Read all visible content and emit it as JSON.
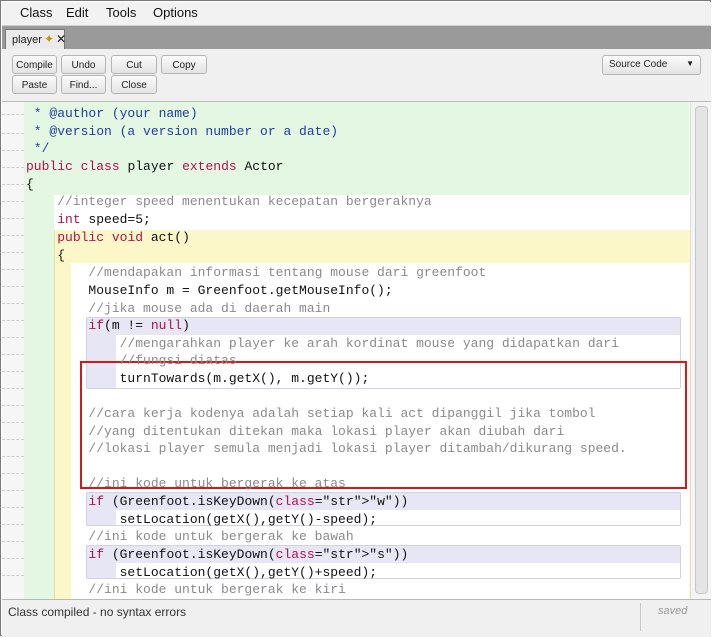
{
  "menu": {
    "class": "Class",
    "edit": "Edit",
    "tools": "Tools",
    "options": "Options"
  },
  "tab": {
    "label": "player",
    "close": "✕"
  },
  "toolbar": {
    "compile": "Compile",
    "undo": "Undo",
    "cut": "Cut",
    "copy": "Copy",
    "paste": "Paste",
    "find": "Find...",
    "close": "Close",
    "view_select": "Source Code"
  },
  "code_lines": [
    " * @author (your name)",
    " * @version (a version number or a date)",
    " */",
    "public class player extends Actor",
    "{",
    "    //integer speed menentukan kecepatan bergeraknya",
    "    int speed=5;",
    "    public void act()",
    "    {",
    "        //mendapakan informasi tentang mouse dari greenfoot",
    "        MouseInfo m = Greenfoot.getMouseInfo();",
    "        //jika mouse ada di daerah main",
    "        if(m != null)",
    "            //mengarahkan player ke arah kordinat mouse yang didapatkan dari",
    "            //fungsi diatas",
    "            turnTowards(m.getX(), m.getY());",
    "",
    "        //cara kerja kodenya adalah setiap kali act dipanggil jika tombol",
    "        //yang ditentukan ditekan maka lokasi player akan diubah dari",
    "        //lokasi player semula menjadi lokasi player ditambah/dikurang speed.",
    "",
    "        //ini kode untuk bergerak ke atas",
    "        if (Greenfoot.isKeyDown(\"w\"))",
    "            setLocation(getX(),getY()-speed);",
    "        //ini kode untuk bergerak ke bawah",
    "        if (Greenfoot.isKeyDown(\"s\"))",
    "            setLocation(getX(),getY()+speed);",
    "        //ini kode untuk bergerak ke kiri"
  ],
  "status": {
    "message": "Class compiled - no syntax errors",
    "saved": "saved"
  }
}
